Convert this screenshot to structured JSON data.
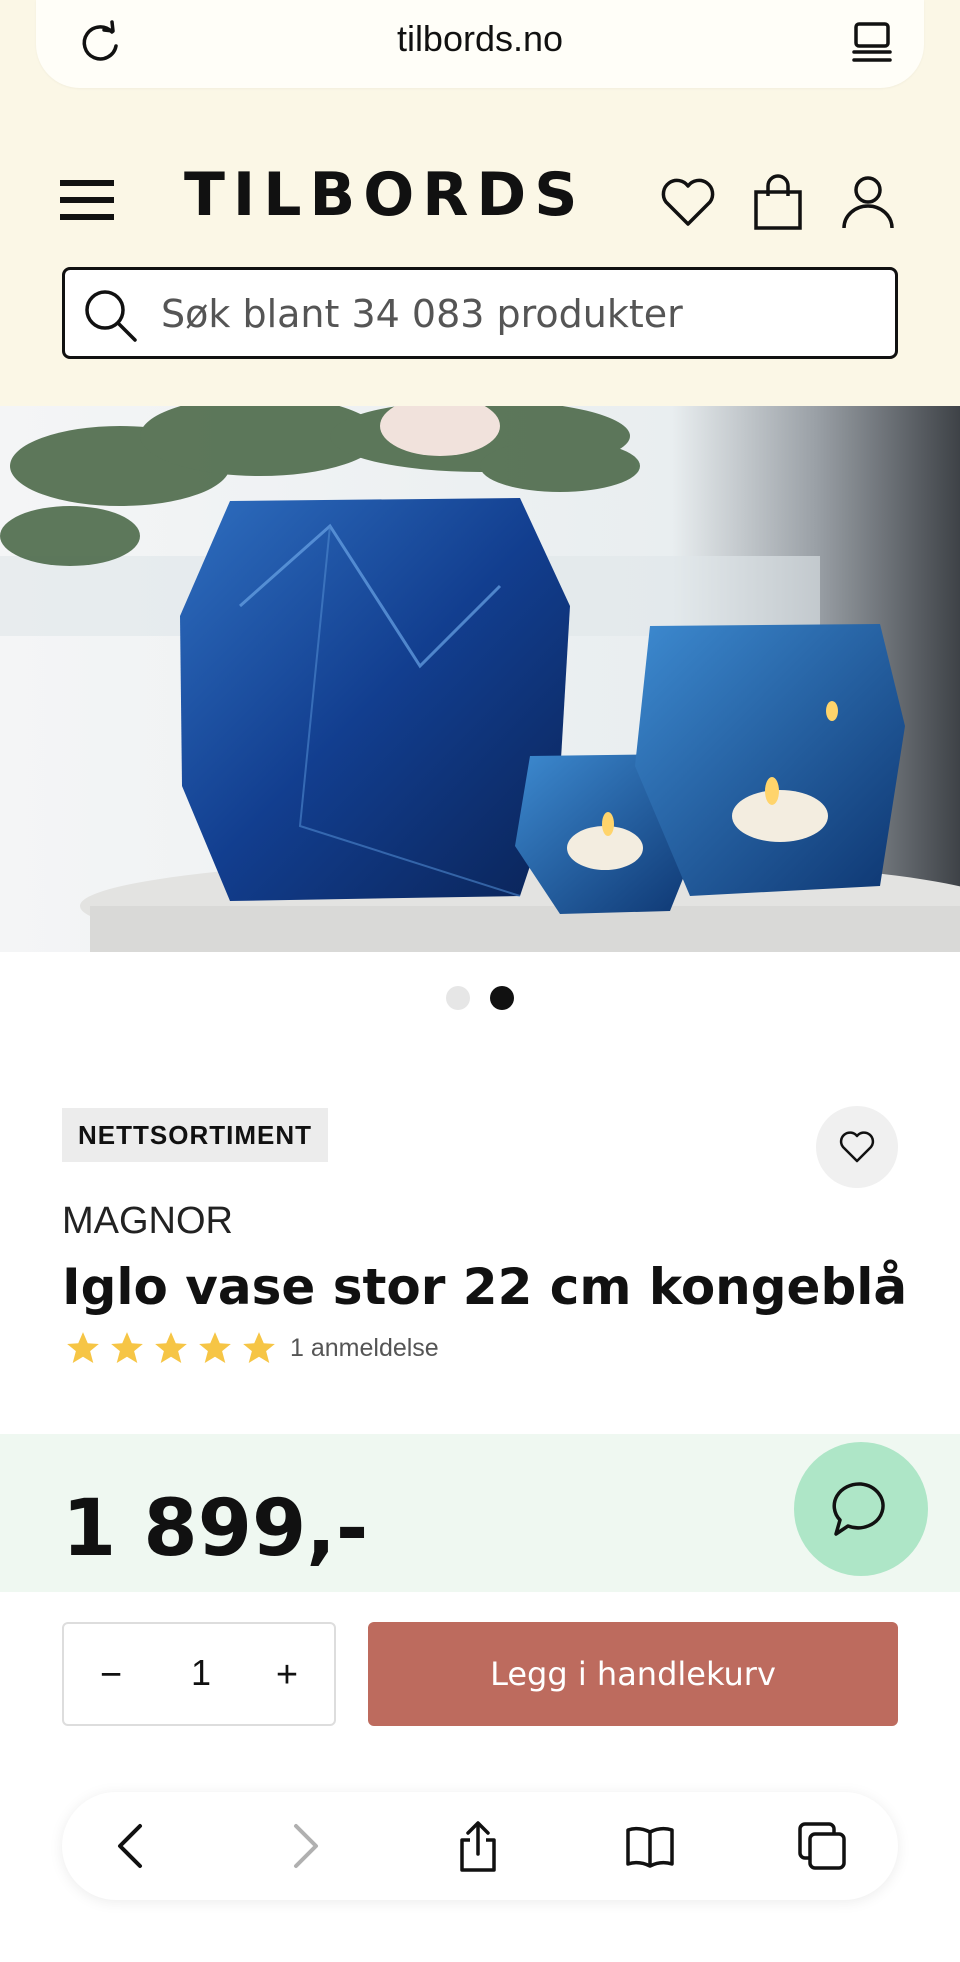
{
  "browser": {
    "url": "tilbords.no",
    "reload_icon": "reload-icon",
    "reader_icon": "reader-mode-icon"
  },
  "header": {
    "logo_text": "TILBORDS",
    "menu_icon": "hamburger-menu-icon",
    "wishlist_icon": "heart-icon",
    "cart_icon": "shopping-bag-icon",
    "account_icon": "user-icon"
  },
  "search": {
    "placeholder": "Søk blant 34 083 produkter",
    "value": ""
  },
  "gallery": {
    "image_description_icon": "product-photo",
    "total_slides": 2,
    "active_slide": 2
  },
  "product": {
    "badge": "NETTSORTIMENT",
    "brand": "MAGNOR",
    "title": "Iglo vase stor 22 cm kongeblå",
    "rating": 5,
    "rating_max": 5,
    "reviews_label": "1 anmeldelse",
    "price": "1 899,-"
  },
  "purchase": {
    "quantity": "1",
    "minus_label": "−",
    "plus_label": "+",
    "add_to_cart_label": "Legg i handlekurv"
  },
  "colors": {
    "header_bg": "#fbf7e6",
    "price_bg": "#eff8f1",
    "chat_bg": "#aee6c7",
    "cart_button": "#bd6b5e",
    "star": "#f6c545"
  },
  "toolbar": {
    "back_icon": "back-icon",
    "forward_icon": "forward-icon",
    "share_icon": "share-icon",
    "bookmarks_icon": "bookmarks-icon",
    "tabs_icon": "tabs-icon"
  }
}
